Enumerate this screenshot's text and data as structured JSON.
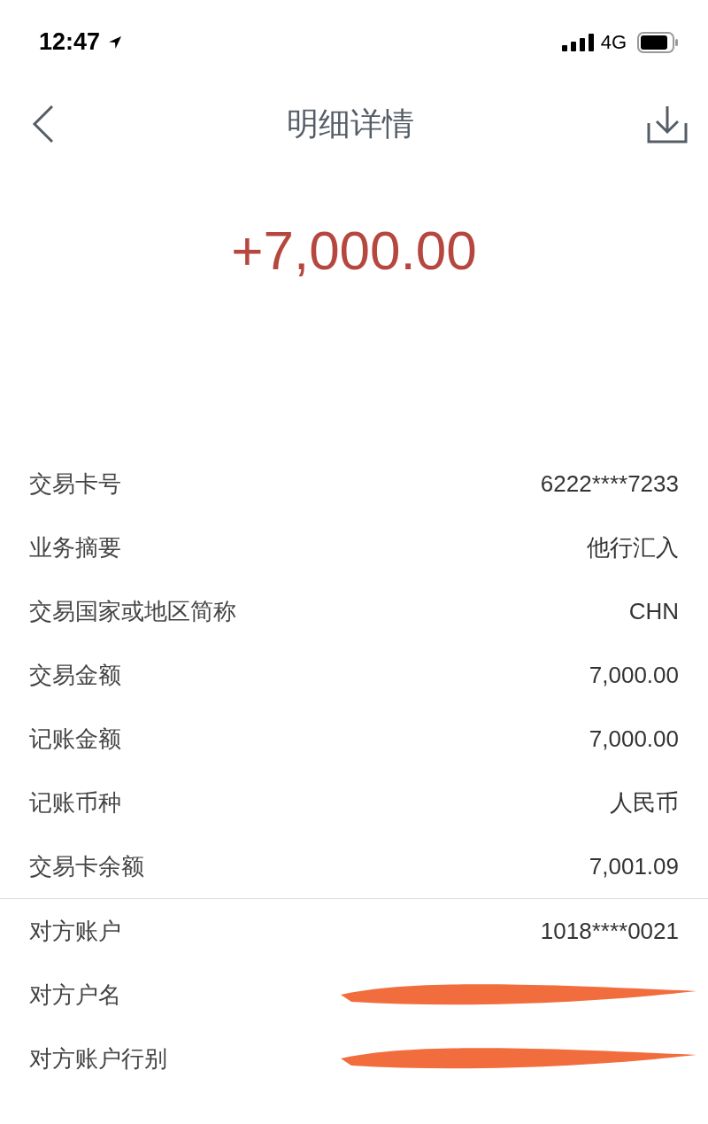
{
  "status_bar": {
    "time": "12:47",
    "network": "4G"
  },
  "header": {
    "title": "明细详情"
  },
  "amount": "+7,000.00",
  "sections": [
    {
      "rows": [
        {
          "label": "交易卡号",
          "value": "6222****7233",
          "redacted": false
        },
        {
          "label": "业务摘要",
          "value": "他行汇入",
          "redacted": false
        },
        {
          "label": "交易国家或地区简称",
          "value": "CHN",
          "redacted": false
        },
        {
          "label": "交易金额",
          "value": "7,000.00",
          "redacted": false
        },
        {
          "label": "记账金额",
          "value": "7,000.00",
          "redacted": false
        },
        {
          "label": "记账币种",
          "value": "人民币",
          "redacted": false
        },
        {
          "label": "交易卡余额",
          "value": "7,001.09",
          "redacted": false
        }
      ]
    },
    {
      "rows": [
        {
          "label": "对方账户",
          "value": "1018****0021",
          "redacted": false
        },
        {
          "label": "对方户名",
          "redacted": true
        },
        {
          "label": "对方账户行别",
          "redacted": true
        }
      ]
    }
  ]
}
